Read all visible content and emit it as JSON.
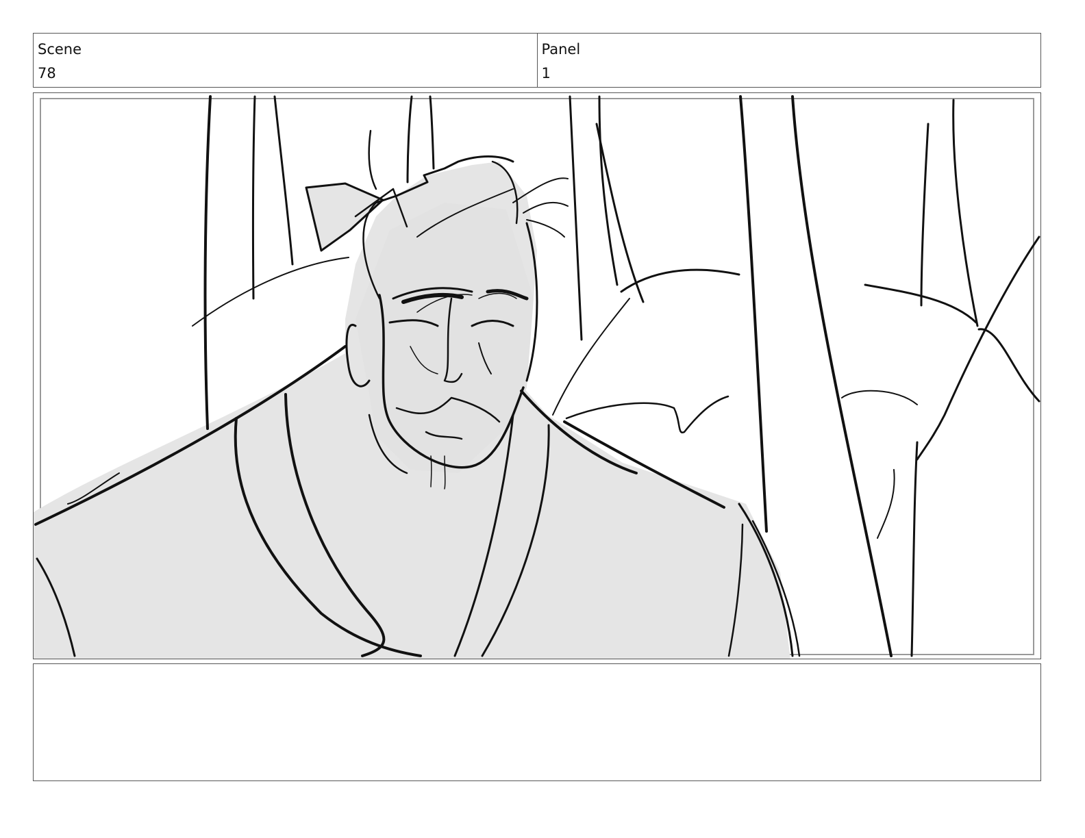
{
  "header": {
    "scene_label": "Scene",
    "scene_value": "78",
    "panel_label": "Panel",
    "panel_value": "1"
  },
  "drawing": {
    "subject": "storyboard-sketch-elderly-man-bamboo-forest",
    "fill_color": "#e5e5e5",
    "line_color": "#111111"
  },
  "notes": {
    "text": ""
  }
}
